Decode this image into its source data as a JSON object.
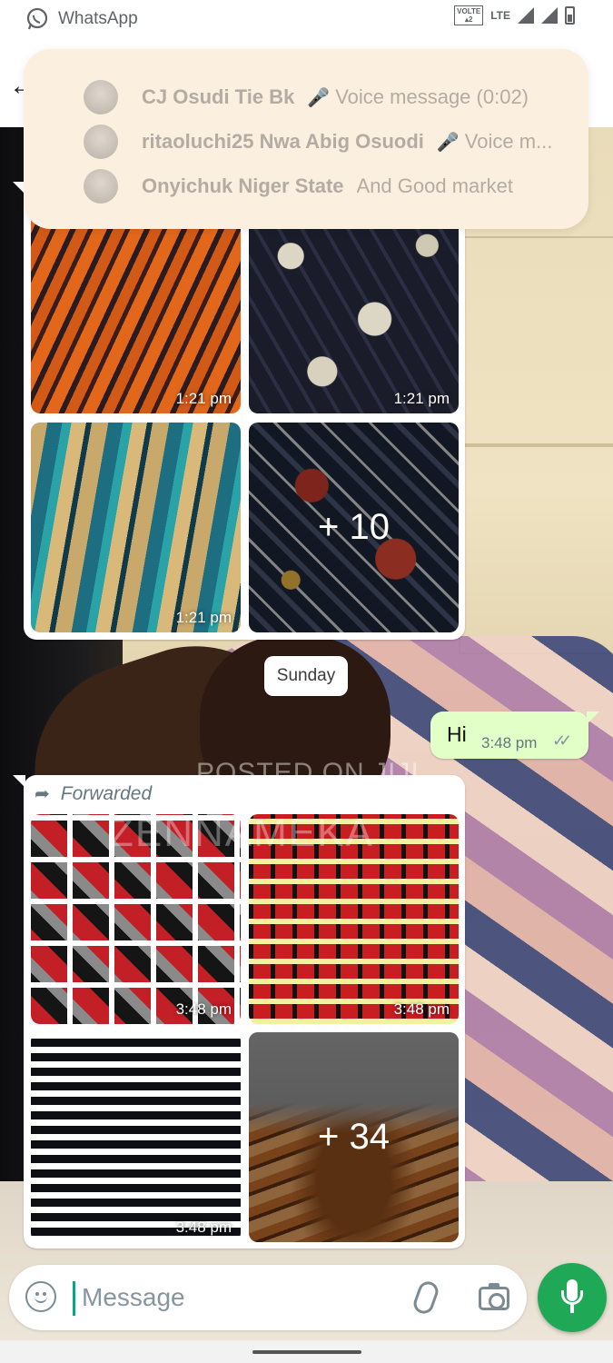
{
  "status_bar": {
    "notification_app": "WhatsApp",
    "volte_label": "VOLTE",
    "network": "LTE"
  },
  "notification": {
    "items": [
      {
        "sender": "CJ Osudi Tie Bk",
        "message": "Voice message (0:02)",
        "icon": "mic-icon"
      },
      {
        "sender": "ritaoluchi25 Nwa Abig Osuodi",
        "message": "Voice m...",
        "icon": "mic-icon"
      },
      {
        "sender": "Onyichuk Niger State",
        "message": "And Good market",
        "icon": ""
      }
    ]
  },
  "chat": {
    "group1": {
      "images": [
        {
          "time": "1:21 pm",
          "pattern": "orange-tiger-stripes"
        },
        {
          "time": "1:21 pm",
          "pattern": "navy-hexagon-print"
        },
        {
          "time": "1:21 pm",
          "pattern": "teal-gold-feather"
        },
        {
          "more": "+ 10",
          "pattern": "navy-red-print"
        }
      ]
    },
    "date_divider": "Sunday",
    "outgoing": {
      "text": "Hi",
      "time": "3:48 pm",
      "status_icon": "double-check-icon"
    },
    "group2": {
      "forwarded_label": "Forwarded",
      "images": [
        {
          "time": "3:48 pm",
          "pattern": "red-black-squares"
        },
        {
          "time": "3:48 pm",
          "pattern": "red-yellow-grid"
        },
        {
          "time": "3:48 pm",
          "pattern": "black-white-dashes"
        },
        {
          "more": "+ 34",
          "pattern": "brown-leopard"
        }
      ]
    },
    "watermark_line1": "POSTED ON JIJI",
    "watermark_line2": "ZENNAMEKA"
  },
  "input_bar": {
    "placeholder": "Message"
  },
  "colors": {
    "accent_green": "#1fa855",
    "outgoing_bubble": "#e2ffc7",
    "notification_bg": "#fbefe0"
  }
}
